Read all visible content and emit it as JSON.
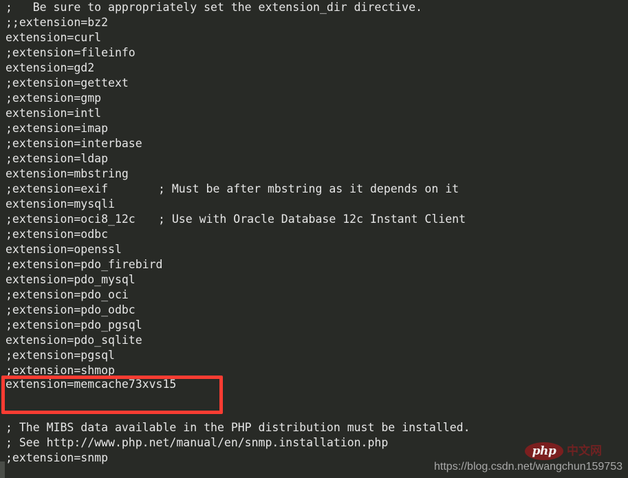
{
  "editor": {
    "background_color": "#282a26",
    "text_color": "#e6e6e6",
    "highlight_color": "#fa3c32",
    "lines": [
      {
        "text": ";   Be sure to appropriately set the extension_dir directive.",
        "comment": ""
      },
      {
        "text": ";;extension=bz2",
        "comment": ""
      },
      {
        "text": "extension=curl",
        "comment": ""
      },
      {
        "text": ";extension=fileinfo",
        "comment": ""
      },
      {
        "text": "extension=gd2",
        "comment": ""
      },
      {
        "text": ";extension=gettext",
        "comment": ""
      },
      {
        "text": ";extension=gmp",
        "comment": ""
      },
      {
        "text": "extension=intl",
        "comment": ""
      },
      {
        "text": ";extension=imap",
        "comment": ""
      },
      {
        "text": ";extension=interbase",
        "comment": ""
      },
      {
        "text": ";extension=ldap",
        "comment": ""
      },
      {
        "text": "extension=mbstring",
        "comment": ""
      },
      {
        "text": ";extension=exif",
        "comment": "; Must be after mbstring as it depends on it"
      },
      {
        "text": "extension=mysqli",
        "comment": ""
      },
      {
        "text": ";extension=oci8_12c",
        "comment": "; Use with Oracle Database 12c Instant Client"
      },
      {
        "text": ";extension=odbc",
        "comment": ""
      },
      {
        "text": "extension=openssl",
        "comment": ""
      },
      {
        "text": ";extension=pdo_firebird",
        "comment": ""
      },
      {
        "text": "extension=pdo_mysql",
        "comment": ""
      },
      {
        "text": ";extension=pdo_oci",
        "comment": ""
      },
      {
        "text": ";extension=pdo_odbc",
        "comment": ""
      },
      {
        "text": ";extension=pdo_pgsql",
        "comment": ""
      },
      {
        "text": "extension=pdo_sqlite",
        "comment": ""
      },
      {
        "text": ";extension=pgsql",
        "comment": ""
      },
      {
        "text": ";extension=shmop",
        "comment": ""
      }
    ],
    "highlighted_line": "extension=memcache73xvs15",
    "footer_lines": [
      {
        "text": "; The MIBS data available in the PHP distribution must be installed.",
        "comment": ""
      },
      {
        "text": "; See http://www.php.net/manual/en/snmp.installation.php",
        "comment": ""
      },
      {
        "text": ";extension=snmp",
        "comment": ""
      }
    ]
  },
  "watermark": {
    "url": "https://blog.csdn.net/wangchun159753",
    "logo_text": "php",
    "logo_suffix": "中文网",
    "logo_color": "#7b1f1f"
  }
}
